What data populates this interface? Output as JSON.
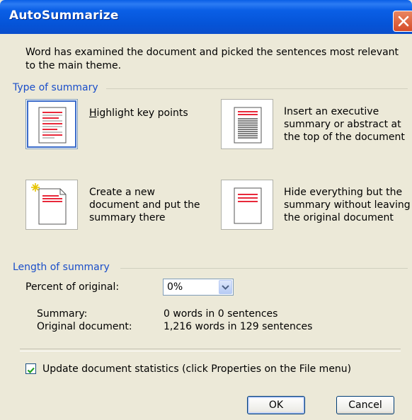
{
  "window": {
    "title": "AutoSummarize"
  },
  "intro": {
    "line1": "Word has examined the document and picked the sentences most relevant",
    "line2": "to the main theme."
  },
  "type_group": {
    "label": "Type of summary",
    "options": [
      {
        "lines": [
          "Highlight key points"
        ],
        "selected": true
      },
      {
        "lines": [
          "Insert an executive",
          "summary or abstract at",
          "the top of the document"
        ]
      },
      {
        "lines": [
          "Create a new",
          "document and put the",
          "summary there"
        ]
      },
      {
        "lines": [
          "Hide everything but the",
          "summary without leaving",
          "the original document"
        ]
      }
    ]
  },
  "length_group": {
    "label": "Length of summary",
    "percent_label": "Percent of original:",
    "percent_value": "0%",
    "summary_label": "Summary:",
    "summary_value": "0 words in 0 sentences",
    "original_label": "Original document:",
    "original_value": "1,216 words in 129 sentences"
  },
  "update_stats": {
    "label": "Update document statistics (click Properties on the File menu)",
    "checked": true
  },
  "buttons": {
    "ok": "OK",
    "cancel": "Cancel"
  },
  "colors": {
    "title_bar": "#0A5FE6",
    "group_label": "#1a4ec9",
    "highlight_red": "#E8283A",
    "dialog_bg": "#ECE9D8"
  }
}
